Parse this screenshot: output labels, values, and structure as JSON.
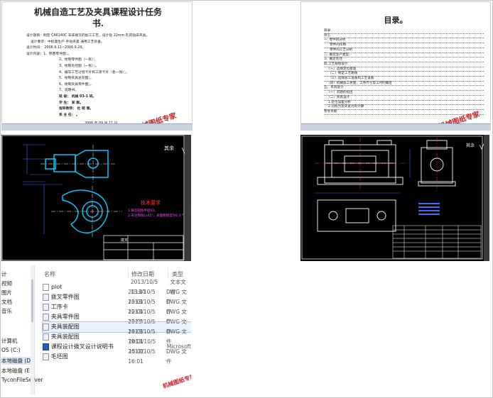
{
  "doc1": {
    "title_line1": "机械自造工艺及夹具课程设计任务",
    "title_line2": "书.",
    "lines": [
      "设计题目：制定 CA6140C 车床拨叉的加工工艺，设计钻 22mm 孔的钻床夹具。",
      "设计要求：中批量生产    手动夹紧    通用工艺装备。",
      "设计时间：    2006.9.11~2006.9.29。",
      "设计内容：1、熟悉零件图；。",
      "2、绘制零件图（一张）；",
      "3、绘制毛坯图（一张）；。",
      "4、编写工艺过程卡片和工序卡片（各一张）；。",
      "5、绘制夹具总装图；。",
      "6、绘制夹具零件图；。",
      "7、说明书。"
    ],
    "sign_class": "班    级：  机械 03-1 班。",
    "sign_student": "学    生：  某  群。",
    "sign_teacher": "指导教师：  杜 晓 春。",
    "sign_director": "系 主 任：  。",
    "date": "2006 年 09 月 11 日。",
    "watermark": "机械图纸专家"
  },
  "doc2": {
    "title": "目录。",
    "toc": [
      "目录",
      "序言",
      "一. 零件的分析",
      "零件的作用",
      "零件的工艺分析",
      "二. 确定生产类型",
      "三. 确定毛坯",
      "四.工艺规程设计",
      "（一）选择定位基准",
      "（二）制定工艺路线",
      "（三）选择加工设备和工艺设备",
      "（四）机械加工余量、工序尺寸及工时的确定",
      "五、夹具设计",
      "（一）问题的指出",
      "（二）夹具设计",
      "1.定位误差分析",
      "2.切削力及夹紧力的计算",
      "参考文献"
    ],
    "watermark": "机械图纸专家"
  },
  "cad1": {
    "note_title": "技术要求",
    "note_1": "1.铸造圆角半径R3。",
    "note_2": "2.未注倒角1x45°，表面粗糙度为6.3 气孔",
    "corner": "其余",
    "title_block": "拨叉"
  },
  "cad2": {
    "corner": "其余"
  },
  "explorer": {
    "headers": {
      "name": "名称",
      "date": "修改日期",
      "type": "类型"
    },
    "nav": [
      "计",
      "视频",
      "图片",
      "文档",
      "音乐",
      "",
      "计算机",
      "OS (C:)",
      "本地磁盘 (D:)",
      "本地磁盘 (E:)",
      "TyconFileServer"
    ],
    "files": [
      {
        "name": "plot",
        "date": "2013/10/5 13:01",
        "type": "文本文档",
        "icon": "text-file-icon"
      },
      {
        "name": "拨叉零件图",
        "date": "2013/10/5 13:01",
        "type": "DWG 文件",
        "icon": "dwg-file-icon"
      },
      {
        "name": "工序卡",
        "date": "2013/10/5 12:01",
        "type": "DWG 文件",
        "icon": "dwg-file-icon"
      },
      {
        "name": "夹具零件图",
        "date": "2013/10/5 13:01",
        "type": "DWG 文件",
        "icon": "dwg-file-icon"
      },
      {
        "name": "夹具装配图",
        "date": "2013/10/5 18:01",
        "type": "DWG 文件",
        "icon": "dwg-file-icon"
      },
      {
        "name": "夹具装配图",
        "date": "2013/10/5 18:01",
        "type": "DWG 文件",
        "icon": "dwg-file-icon"
      },
      {
        "name": "课程设计拨叉设计说明书",
        "date": "2013/10/5 15:01",
        "type": "Microsoft",
        "icon": "word-doc-icon"
      },
      {
        "name": "毛坯图",
        "date": "2013/10/5 16:01",
        "type": "DWG 文件",
        "icon": "dwg-file-icon"
      }
    ],
    "watermark": "机械图纸专家"
  }
}
